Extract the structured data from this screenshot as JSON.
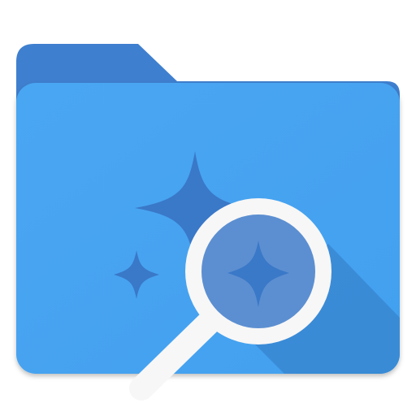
{
  "icon": {
    "kind": "folder-search-icon",
    "colors": {
      "folder_back": "#3f7fcf",
      "folder_front": "#42a0ef",
      "folder_front_light": "#4aa6f2",
      "sparkle": "#3a78c8",
      "lens_tint": "#5c8fd1",
      "magnifier_frame": "#f7f7f7",
      "shadow": "#2f71b8"
    }
  }
}
